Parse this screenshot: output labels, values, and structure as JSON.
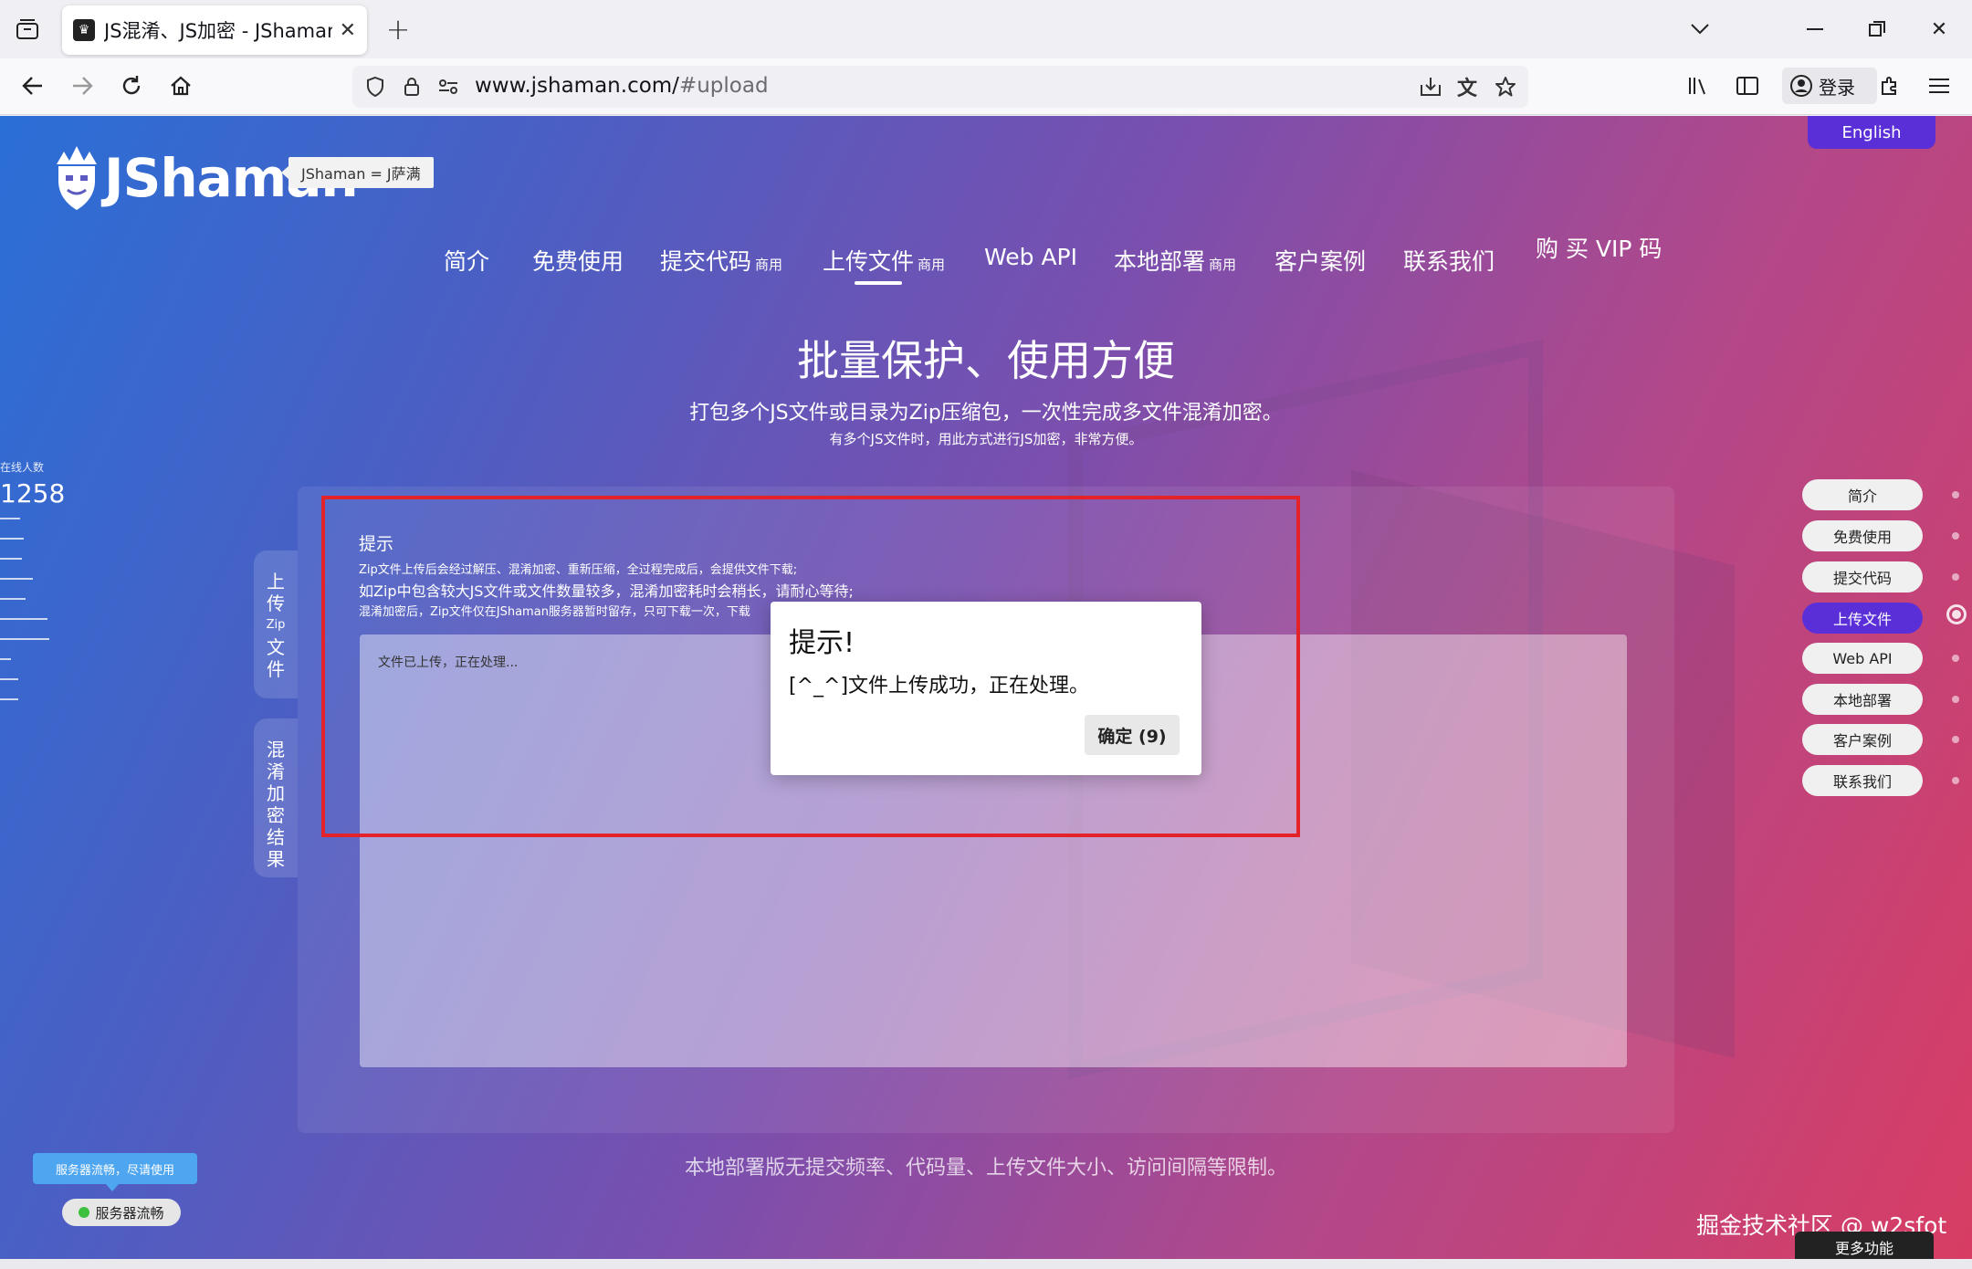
{
  "browser": {
    "tab_title": "JS混淆、JS加密 - JShaman专业",
    "url_host": "www.jshaman.com/",
    "url_path": "#upload",
    "signin_label": "登录"
  },
  "page": {
    "lang_button": "English",
    "logo_word": "JShaman",
    "logo_tag": "JShaman = J萨满",
    "nav": [
      {
        "label": "简介",
        "suffix": ""
      },
      {
        "label": "免费使用",
        "suffix": ""
      },
      {
        "label": "提交代码",
        "suffix": "商用"
      },
      {
        "label": "上传文件",
        "suffix": "商用"
      },
      {
        "label": "Web API",
        "suffix": ""
      },
      {
        "label": "本地部署",
        "suffix": "商用"
      },
      {
        "label": "客户案例",
        "suffix": ""
      },
      {
        "label": "联系我们",
        "suffix": ""
      },
      {
        "label": "购 买 VIP 码",
        "suffix": ""
      }
    ],
    "hero_title": "批量保护、使用方便",
    "hero_sub": "打包多个JS文件或目录为Zip压缩包，一次性完成多文件混淆加密。",
    "hero_note": "有多个JS文件时，用此方式进行JS加密，非常方便。",
    "online_label": "在线人数",
    "online_count": "1258",
    "side_tab_upload": [
      "上",
      "传",
      "Zip",
      "文",
      "件"
    ],
    "side_tab_result": [
      "混",
      "淆",
      "加",
      "密",
      "结",
      "果"
    ],
    "tips_title": "提示",
    "tips_line1": "Zip文件上传后会经过解压、混淆加密、重新压缩，全过程完成后，会提供文件下载;",
    "tips_line2": "如Zip中包含较大JS文件或文件数量较多，混淆加密耗时会稍长，请耐心等待;",
    "tips_line3": "混淆加密后，Zip文件仅在JShaman服务器暂时留存，只可下载一次，下载",
    "output_text": "文件已上传，正在处理...",
    "dialog_title": "提示!",
    "dialog_message": "[^_^]文件上传成功，正在处理。",
    "dialog_ok": "确定 (9)",
    "bottom_note": "本地部署版无提交频率、代码量、上传文件大小、访问间隔等限制。",
    "side_nav": [
      "简介",
      "免费使用",
      "提交代码",
      "上传文件",
      "Web API",
      "本地部署",
      "客户案例",
      "联系我们"
    ],
    "server_tip": "服务器流畅，尽请使用",
    "server_status": "服务器流畅",
    "watermark": "掘金技术社区 @ w2sfot",
    "more_button": "更多功能"
  }
}
